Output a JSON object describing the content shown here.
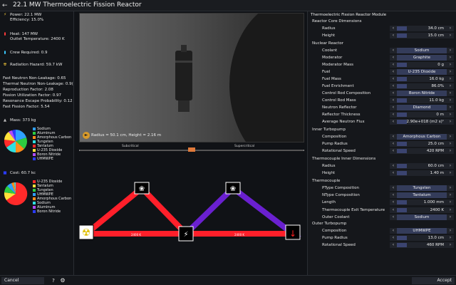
{
  "window": {
    "title": "22.1 MW Thermoelectric Fission Reactor",
    "back_icon": "arrow-back-icon"
  },
  "stats": {
    "power": "Power: 22.1 MW",
    "efficiency": "Efficiency: 15.0%",
    "heat": "Heat: 147 MW",
    "outlet_temp": "Outlet Temperature: 2400 K",
    "crew": "Crew Required: 0.9",
    "radiation": "Radiation Hazard: 59.7 kW",
    "fast_leak": "Fast Neutron Non-Leakage: 0.65",
    "thermal_leak": "Thermal Neutron Non-Leakage: 0.9(",
    "reproduction": "Reproduction Factor: 2.08",
    "fission_util": "Fission Utilization Factor: 0.97",
    "resonance": "Resonance Escape Probability: 0.12",
    "fast_fission": "Fast Fission Factor: 5.54"
  },
  "mass_pie": {
    "title": "Mass: 373 kg",
    "legend": [
      {
        "name": "Sodium",
        "color": "#2fa0ff"
      },
      {
        "name": "Aluminum",
        "color": "#2ecc40"
      },
      {
        "name": "Amorphous Carbon",
        "color": "#ff8c1a"
      },
      {
        "name": "Tungsten",
        "color": "#30e0e0"
      },
      {
        "name": "Tantalum",
        "color": "#ff2a2a"
      },
      {
        "name": "U-235 Dioxide",
        "color": "#ffe23a"
      },
      {
        "name": "Boron Nitride",
        "color": "#b04cff"
      },
      {
        "name": "UHMWPE",
        "color": "#2a3cff"
      }
    ]
  },
  "cost_pie": {
    "title": "Cost: 60.7 kc",
    "legend": [
      {
        "name": "U-235 Dioxide",
        "color": "#ff2a2a"
      },
      {
        "name": "Tantalum",
        "color": "#ffe23a"
      },
      {
        "name": "Tungsten",
        "color": "#2ecc40"
      },
      {
        "name": "UHMWPE",
        "color": "#2fa0ff"
      },
      {
        "name": "Amorphous Carbon",
        "color": "#ff8c1a"
      },
      {
        "name": "Sodium",
        "color": "#30e0e0"
      },
      {
        "name": "Aluminum",
        "color": "#b04cff"
      },
      {
        "name": "Boron Nitride",
        "color": "#2a3cff"
      }
    ]
  },
  "viewport": {
    "caption": "Radius = 50.1 cm, Height = 2.16 m",
    "play_icon": "play-icon"
  },
  "slider": {
    "left_label": "Subcritical",
    "right_label": "Supercritical",
    "position_pct": 50
  },
  "diagram": {
    "hot_reservoir_icon": "radiation-icon",
    "cold_reservoir_icon": "thermometer-icon",
    "node_labels": [
      "",
      "",
      "",
      ""
    ],
    "edges": [
      {
        "label": "2400 K"
      },
      {
        "label": "2400 K"
      }
    ]
  },
  "right": {
    "module_title": "Thermoelectric Fission Reactor Module",
    "core_dims": {
      "title": "Reactor Core Dimensions",
      "radius_label": "Radius",
      "radius_val": "34.0 cm",
      "height_label": "Height",
      "height_val": "15.0 cm"
    },
    "nuclear": {
      "title": "Nuclear Reactor",
      "rows": [
        {
          "label": "Coolant",
          "value": "Sodium",
          "kind": "button"
        },
        {
          "label": "Moderator",
          "value": "Graphite",
          "kind": "button"
        },
        {
          "label": "Moderator Mass",
          "value": "0 g",
          "kind": "slider"
        },
        {
          "label": "Fuel",
          "value": "U-235 Dioxide",
          "kind": "button"
        },
        {
          "label": "Fuel Mass",
          "value": "16.0 kg",
          "kind": "slider"
        },
        {
          "label": "Fuel Enrichment",
          "value": "86.0%",
          "kind": "slider"
        },
        {
          "label": "Control Rod Composition",
          "value": "Boron Nitride",
          "kind": "button"
        },
        {
          "label": "Control Rod Mass",
          "value": "11.0 kg",
          "kind": "slider"
        },
        {
          "label": "Neutron Reflector",
          "value": "Diamond",
          "kind": "button"
        },
        {
          "label": "Reflector Thickness",
          "value": "0 m",
          "kind": "slider"
        },
        {
          "label": "Average Neutron Flux",
          "value": "2.90e+018 (m2 s)¹",
          "kind": "slider"
        }
      ]
    },
    "inner_turbo": {
      "title": "Inner Turbopump",
      "rows": [
        {
          "label": "Composition",
          "value": "Amorphous Carbon",
          "kind": "button"
        },
        {
          "label": "Pump Radius",
          "value": "25.0 cm",
          "kind": "slider"
        },
        {
          "label": "Rotational Speed",
          "value": "420 RPM",
          "kind": "slider"
        }
      ]
    },
    "thermo_inner": {
      "title": "Thermocouple Inner Dimensions",
      "rows": [
        {
          "label": "Radius",
          "value": "60.0 cm",
          "kind": "slider"
        },
        {
          "label": "Height",
          "value": "1.40 m",
          "kind": "slider"
        }
      ]
    },
    "thermocouple": {
      "title": "Thermocouple",
      "rows": [
        {
          "label": "PType Composition",
          "value": "Tungsten",
          "kind": "button"
        },
        {
          "label": "NType Composition",
          "value": "Tantalum",
          "kind": "button"
        },
        {
          "label": "Length",
          "value": "1.000 mm",
          "kind": "slider"
        }
      ]
    },
    "exit_temp": {
      "label": "Thermocouple Exit Temperature",
      "value": "2400 K"
    },
    "outer_coolant": {
      "label": "Outer Coolant",
      "value": "Sodium"
    },
    "outer_turbo": {
      "title": "Outer Turbopump",
      "rows": [
        {
          "label": "Composition",
          "value": "UHMWPE",
          "kind": "button"
        },
        {
          "label": "Pump Radius",
          "value": "13.0 cm",
          "kind": "slider"
        },
        {
          "label": "Rotational Speed",
          "value": "460 RPM",
          "kind": "slider"
        }
      ]
    }
  },
  "bottom": {
    "cancel": "Cancel",
    "help": "?",
    "accept": "Accept",
    "gear_icon": "gear-icon"
  }
}
